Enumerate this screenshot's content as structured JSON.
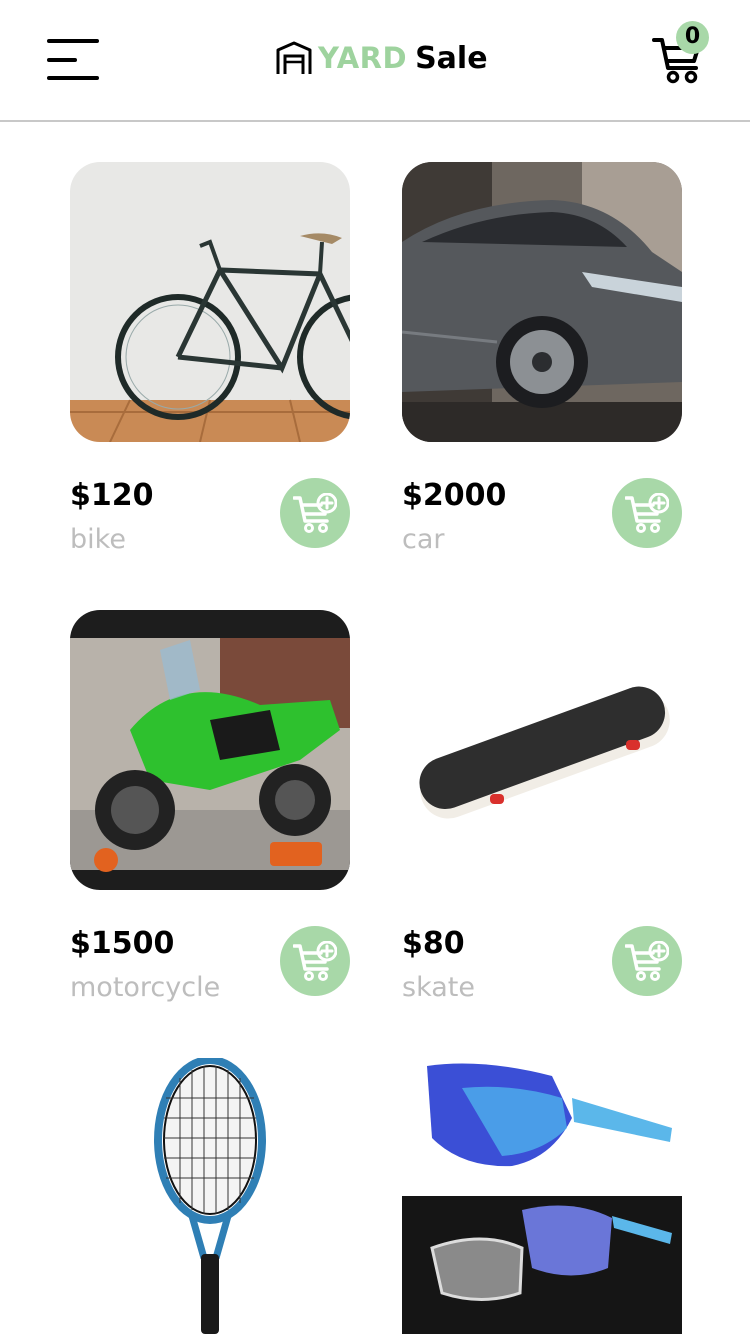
{
  "header": {
    "brand_word1": "YARD",
    "brand_word2": "Sale",
    "cart_count": "0",
    "menu_icon": "hamburger-menu-icon",
    "cart_icon": "shopping-cart-icon",
    "brand_icon": "garage-icon"
  },
  "colors": {
    "accent": "#a8d8a8",
    "brand_green": "#9ed39e",
    "muted_text": "#bdbdbd",
    "divider": "#c8c8c8"
  },
  "products": [
    {
      "price": "$120",
      "name": "bike",
      "image": "bicycle-photo"
    },
    {
      "price": "$2000",
      "name": "car",
      "image": "car-photo"
    },
    {
      "price": "$1500",
      "name": "motorcycle",
      "image": "motorcycle-photo"
    },
    {
      "price": "$80",
      "name": "skate",
      "image": "skateboard-photo"
    },
    {
      "price": "",
      "name": "",
      "image": "tennis-racket-photo"
    },
    {
      "price": "",
      "name": "",
      "image": "sunglasses-photo"
    }
  ]
}
